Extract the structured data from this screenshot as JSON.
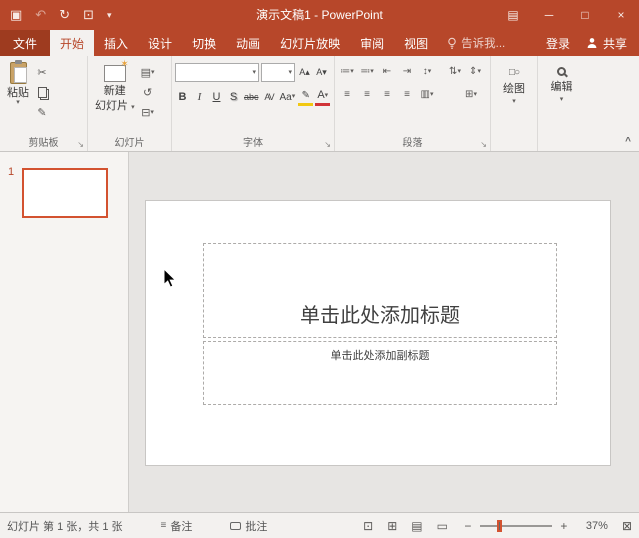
{
  "titlebar": {
    "title": "演示文稿1 - PowerPoint",
    "glyphs": {
      "save": "▣",
      "undo": "↶",
      "redo": "↻",
      "start_slideshow": "⊡",
      "customize": "▾",
      "ribbon_options": "▤",
      "minimize": "─",
      "maximize": "□",
      "close": "×"
    }
  },
  "tabs": {
    "file": "文件",
    "items": [
      "开始",
      "插入",
      "设计",
      "切换",
      "动画",
      "幻灯片放映",
      "审阅",
      "视图"
    ],
    "tell_me": "告诉我...",
    "sign_in": "登录",
    "share": "共享"
  },
  "ribbon": {
    "collapse": "^",
    "clipboard": {
      "label": "剪贴板",
      "paste": "粘贴",
      "glyphs": {
        "cut": "✂",
        "painter": "✎",
        "dropdown": "▾",
        "launcher": "↘"
      }
    },
    "slides": {
      "label": "幻灯片",
      "new_slide_l1": "新建",
      "new_slide_l2": "幻灯片",
      "glyphs": {
        "layout": "▤",
        "reset": "↺",
        "section": "⊟",
        "dropdown": "▾"
      }
    },
    "font": {
      "label": "字体",
      "bold": "B",
      "italic": "I",
      "underline": "U",
      "shadow": "S",
      "strike": "abc",
      "spacing": "AV",
      "case": "Aa",
      "grow": "A▴",
      "shrink": "A▾",
      "clear": "A",
      "highlight": "✎",
      "color": "A",
      "glyphs": {
        "dropdown": "▾",
        "launcher": "↘"
      }
    },
    "paragraph": {
      "label": "段落",
      "glyphs": {
        "bullets": "≔",
        "numbering": "≕",
        "indent_dec": "⇤",
        "indent_inc": "⇥",
        "line_spacing": "↕",
        "direction": "⇅",
        "align_text": "⇕",
        "align": "≡",
        "columns": "▥",
        "smartart": "⊞",
        "dropdown": "▾",
        "launcher": "↘"
      }
    },
    "drawing": {
      "label": "绘图",
      "glyphs": {
        "shapes": "□○",
        "dropdown": "▾"
      }
    },
    "editing": {
      "label": "编辑",
      "glyphs": {
        "dropdown": "▾"
      }
    }
  },
  "thumbnails": {
    "slide_number": "1"
  },
  "slide": {
    "title_placeholder": "单击此处添加标题",
    "subtitle_placeholder": "单击此处添加副标题"
  },
  "statusbar": {
    "slide_info": "幻灯片 第 1 张，共 1 张",
    "notes": "备注",
    "comments": "批注",
    "zoom_out": "−",
    "zoom_in": "+",
    "zoom_level": "37%",
    "glyphs": {
      "notes": "≡",
      "normal": "⊡",
      "sorter": "⊞",
      "reading": "▤",
      "slideshow": "▭",
      "fit": "⊠"
    }
  }
}
